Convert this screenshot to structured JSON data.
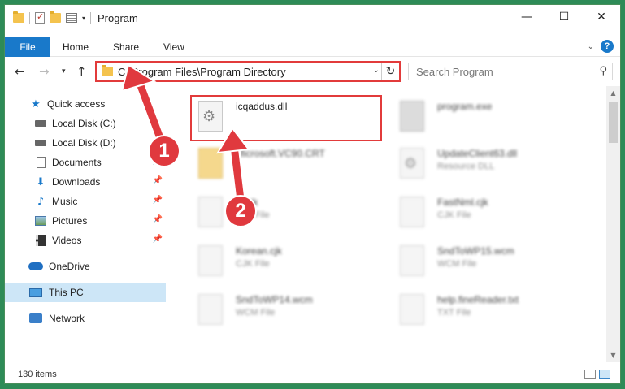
{
  "window": {
    "title": "Program",
    "controls": {
      "minimize": "—",
      "maximize": "☐",
      "close": "✕"
    }
  },
  "ribbon": {
    "tabs": [
      "File",
      "Home",
      "Share",
      "View"
    ],
    "help": "?"
  },
  "address": {
    "path": "C:\\Program Files\\Program Directory",
    "search_placeholder": "Search Program"
  },
  "sidebar": {
    "items": [
      {
        "label": "Quick access",
        "icon": "star-icon"
      },
      {
        "label": "Local Disk (C:)",
        "icon": "drive-icon"
      },
      {
        "label": "Local Disk (D:)",
        "icon": "drive-icon"
      },
      {
        "label": "Documents",
        "icon": "documents-icon"
      },
      {
        "label": "Downloads",
        "icon": "download-icon"
      },
      {
        "label": "Music",
        "icon": "music-icon"
      },
      {
        "label": "Pictures",
        "icon": "pictures-icon"
      },
      {
        "label": "Videos",
        "icon": "videos-icon"
      },
      {
        "label": "OneDrive",
        "icon": "cloud-icon"
      },
      {
        "label": "This PC",
        "icon": "computer-icon",
        "selected": true
      },
      {
        "label": "Network",
        "icon": "network-icon"
      }
    ]
  },
  "files": [
    {
      "name": "icqaddus.dll",
      "type": "",
      "icon": "dll-gear-icon",
      "highlighted": true
    },
    {
      "name": "program.exe",
      "type": "",
      "icon": "exe-icon"
    },
    {
      "name": "Microsoft.VC90.CRT",
      "type": "",
      "icon": "folder-icon"
    },
    {
      "name": "UpdateClient63.dll",
      "type": "Resource DLL",
      "icon": "dll-gear-icon"
    },
    {
      "name": "id.cjk",
      "type": "CJK File",
      "icon": "file-icon"
    },
    {
      "name": "FastNml.cjk",
      "type": "CJK File",
      "icon": "file-icon"
    },
    {
      "name": "Korean.cjk",
      "type": "CJK File",
      "icon": "file-icon"
    },
    {
      "name": "SndToWP15.wcm",
      "type": "WCM File",
      "icon": "file-icon"
    },
    {
      "name": "SndToWP14.wcm",
      "type": "WCM File",
      "icon": "file-icon"
    },
    {
      "name": "help.fineReader.txt",
      "type": "TXT File",
      "icon": "text-file-icon"
    }
  ],
  "status": {
    "count": "130 items"
  },
  "annotations": {
    "step1": "1",
    "step2": "2"
  },
  "colors": {
    "accent": "#1979ca",
    "highlight": "#e23b3b",
    "background": "#2e8b57"
  }
}
